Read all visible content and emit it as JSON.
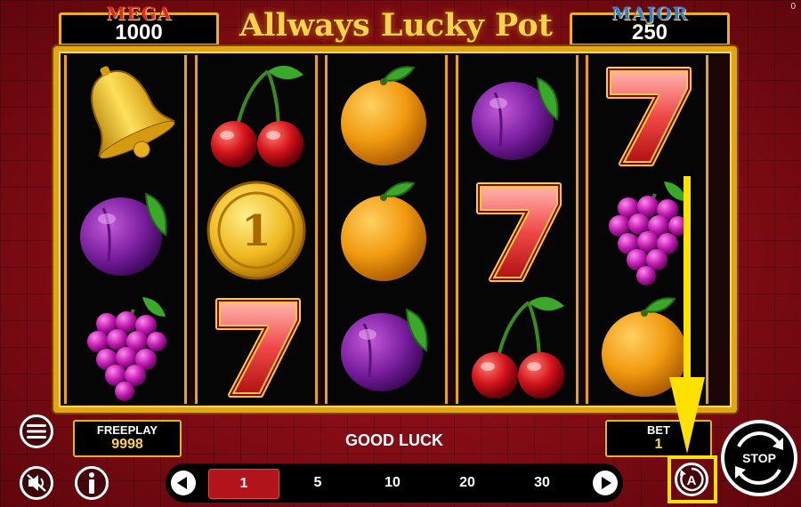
{
  "corner_value": "0",
  "jackpots": {
    "mega": {
      "label": "MEGA",
      "value": "1000",
      "label_color": "#e0262a"
    },
    "major": {
      "label": "MAJOR",
      "value": "250",
      "label_color": "#2f7fe0"
    }
  },
  "title": "Allways Lucky Pot",
  "reels": [
    [
      "bell",
      "plum",
      "grapes"
    ],
    [
      "cherry",
      "coin",
      "seven"
    ],
    [
      "orange",
      "orange",
      "plum"
    ],
    [
      "plum",
      "seven",
      "cherry"
    ],
    [
      "seven",
      "grapes",
      "orange"
    ]
  ],
  "coin_value": "1",
  "freeplay": {
    "label": "FREEPLAY",
    "value": "9998"
  },
  "message": "GOOD LUCK",
  "bet": {
    "label": "BET",
    "value": "1"
  },
  "bet_options": [
    "1",
    "5",
    "10",
    "20",
    "30"
  ],
  "selected_bet_index": 0,
  "stop_label": "STOP",
  "autoplay_label": "A",
  "colors": {
    "gold": "#e3a515",
    "highlight": "#ffe100",
    "accent_red": "#b3141c"
  }
}
